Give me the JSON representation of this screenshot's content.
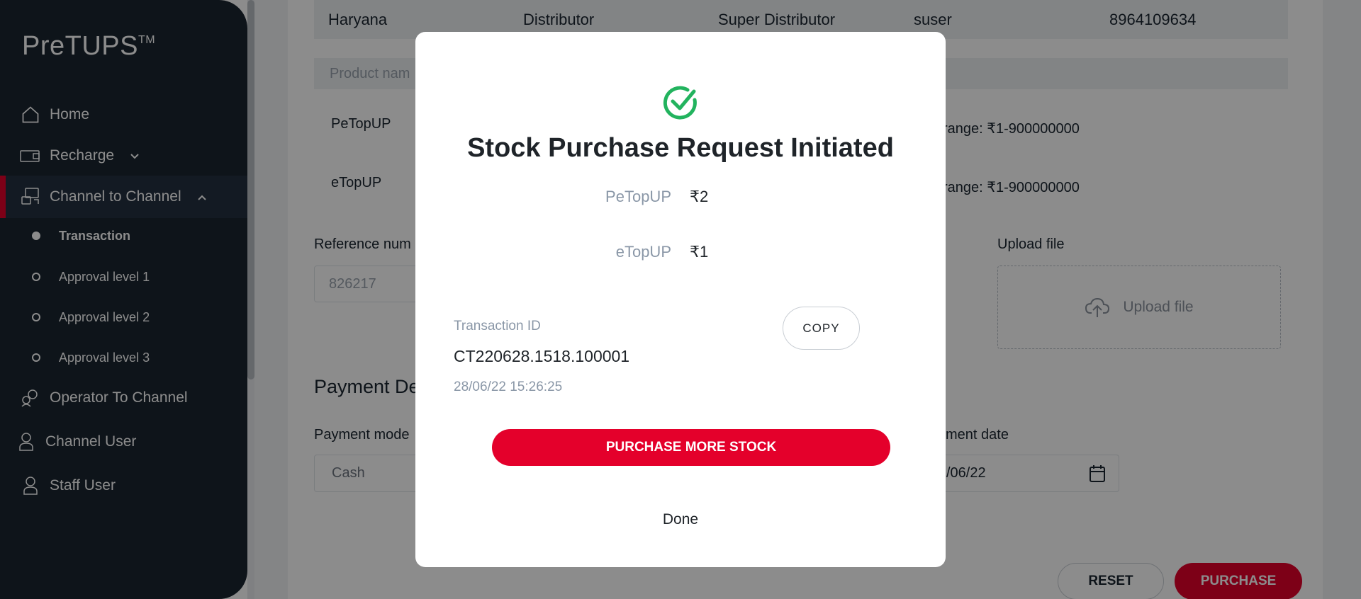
{
  "app": {
    "brand": "PreTUPS",
    "brand_tm": "TM"
  },
  "sidebar": {
    "items": [
      {
        "label": "Home",
        "icon": "home-icon"
      },
      {
        "label": "Recharge",
        "icon": "recharge-icon"
      },
      {
        "label": "Channel to Channel",
        "icon": "channel-to-channel-icon"
      },
      {
        "label": "Operator To Channel",
        "icon": "operator-icon"
      },
      {
        "label": "Channel User",
        "icon": "user-icon"
      },
      {
        "label": "Staff User",
        "icon": "user-icon"
      }
    ],
    "sub_items": [
      {
        "label": "Transaction"
      },
      {
        "label": "Approval level 1"
      },
      {
        "label": "Approval level 2"
      },
      {
        "label": "Approval level 3"
      }
    ]
  },
  "background": {
    "info_row": {
      "state": "Haryana",
      "domain": "Distributor",
      "category": "Super Distributor",
      "user": "suser",
      "mobile": "8964109634"
    },
    "product_header": "Product nam",
    "products": [
      {
        "name": "PeTopUP",
        "range": "range: ₹1-900000000"
      },
      {
        "name": "eTopUP",
        "range": "range: ₹1-900000000"
      }
    ],
    "reference_label": "Reference num",
    "reference_value": "826217",
    "upload_label": "Upload file",
    "upload_button": "Upload file",
    "payment_section_title": "Payment De",
    "payment_mode_label": "Payment mode",
    "payment_mode_value": "Cash",
    "payment_date_label": "ment date",
    "payment_date_value": "/06/22",
    "reset_button": "RESET",
    "purchase_button": "PURCHASE"
  },
  "modal": {
    "title": "Stock Purchase Request Initiated",
    "icon": "success-check-icon",
    "amounts": [
      {
        "product": "PeTopUP",
        "value": "₹2"
      },
      {
        "product": "eTopUP",
        "value": "₹1"
      }
    ],
    "transaction_label": "Transaction ID",
    "transaction_id": "CT220628.1518.100001",
    "timestamp": "28/06/22 15:26:25",
    "copy_button": "COPY",
    "purchase_more_button": "PURCHASE MORE STOCK",
    "done_button": "Done"
  },
  "colors": {
    "accent": "#e4002b",
    "sidebar": "#1b2631",
    "success": "#22b35e"
  }
}
